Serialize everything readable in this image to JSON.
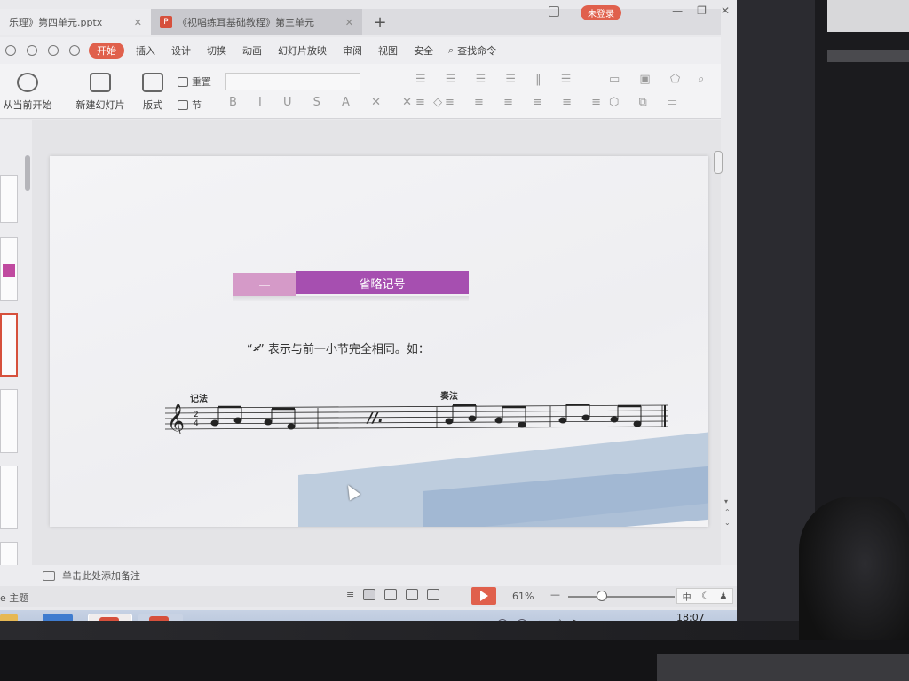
{
  "tabs": [
    {
      "label": "乐理》第四单元.pptx",
      "active": true
    },
    {
      "label": "《视唱练耳基础教程》第三单元",
      "active": false
    }
  ],
  "window": {
    "login_label": "未登录"
  },
  "menu": {
    "items": [
      "开始",
      "插入",
      "设计",
      "切换",
      "动画",
      "幻灯片放映",
      "审阅",
      "视图",
      "安全"
    ],
    "active": "开始",
    "search_label": "查找命令"
  },
  "ribbon": {
    "play_from_current": "从当前开始",
    "new_slide": "新建幻灯片",
    "layout": "版式",
    "reset": "重置",
    "section": "节"
  },
  "slide": {
    "number_label": "一",
    "title": "省略记号",
    "description_prefix": "“",
    "description_symbol": "𝄎",
    "description_text": "” 表示与前一小节完全相同。如：",
    "label_notation": "记法",
    "label_performance": "奏法"
  },
  "notes": {
    "placeholder": "单击此处添加备注"
  },
  "status": {
    "theme_label": "e 主题",
    "zoom": "61%",
    "ime_label": "中"
  },
  "taskbar": {
    "time": "18:07"
  },
  "colors": {
    "accent": "#e0604c",
    "title_bar": "#a64fb0",
    "title_num": "#d59ac8"
  }
}
